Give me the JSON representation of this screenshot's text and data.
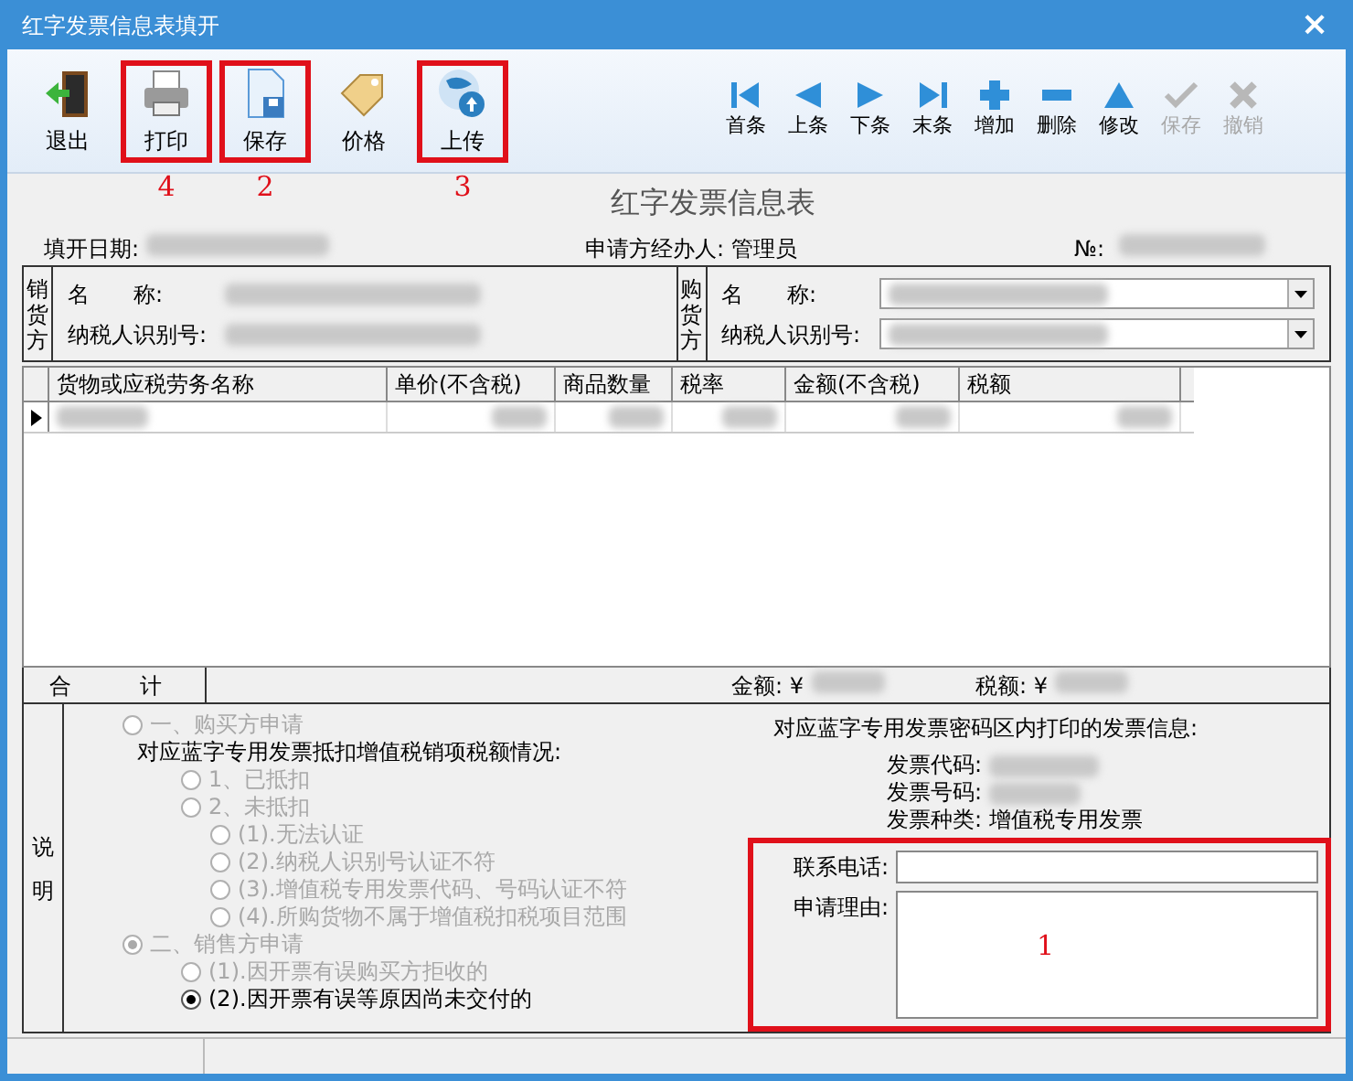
{
  "window": {
    "title": "红字发票信息表填开",
    "close": "×"
  },
  "toolbar": {
    "left": [
      {
        "label": "退出"
      },
      {
        "label": "打印",
        "annotation": "4"
      },
      {
        "label": "保存",
        "annotation": "2"
      },
      {
        "label": "价格"
      },
      {
        "label": "上传",
        "annotation": "3"
      }
    ],
    "right": [
      {
        "label": "首条",
        "disabled": false
      },
      {
        "label": "上条",
        "disabled": false
      },
      {
        "label": "下条",
        "disabled": false
      },
      {
        "label": "末条",
        "disabled": false
      },
      {
        "label": "增加",
        "disabled": false
      },
      {
        "label": "删除",
        "disabled": false
      },
      {
        "label": "修改",
        "disabled": false
      },
      {
        "label": "保存",
        "disabled": true
      },
      {
        "label": "撤销",
        "disabled": true
      }
    ]
  },
  "form": {
    "heading": "红字发票信息表",
    "date_label": "填开日期:",
    "handler": "申请方经办人: 管理员",
    "number_label": "№:"
  },
  "parties": [
    {
      "side": "销货方",
      "name_label": "名　　称:",
      "tax_label": "纳税人识别号:",
      "dropdown": false
    },
    {
      "side": "购货方",
      "name_label": "名　　称:",
      "tax_label": "纳税人识别号:",
      "dropdown": true
    }
  ],
  "table": {
    "columns": [
      "货物或应税劳务名称",
      "单价(不含税)",
      "商品数量",
      "税率",
      "金额(不含税)",
      "税额"
    ],
    "rows": [
      {
        "selected": true
      }
    ]
  },
  "totals": {
    "label_1": "合",
    "label_2": "计",
    "amount_label": "金额: ¥",
    "tax_label": "税额: ¥"
  },
  "notes": {
    "side": "说明",
    "options": [
      {
        "kind": "radio",
        "label": "一、购买方申请",
        "selected": false,
        "disabled": true,
        "children": [
          {
            "kind": "text",
            "label": "对应蓝字专用发票抵扣增值税销项税额情况:"
          },
          {
            "kind": "radio",
            "label": "1、已抵扣",
            "selected": false,
            "disabled": true
          },
          {
            "kind": "radio",
            "label": "2、未抵扣",
            "selected": false,
            "disabled": true,
            "children": [
              {
                "kind": "radio",
                "label": "(1).无法认证",
                "selected": false,
                "disabled": true
              },
              {
                "kind": "radio",
                "label": "(2).纳税人识别号认证不符",
                "selected": false,
                "disabled": true
              },
              {
                "kind": "radio",
                "label": "(3).增值税专用发票代码、号码认证不符",
                "selected": false,
                "disabled": true
              },
              {
                "kind": "radio",
                "label": "(4).所购货物不属于增值税扣税项目范围",
                "selected": false,
                "disabled": true
              }
            ]
          }
        ]
      },
      {
        "kind": "radio",
        "label": "二、销售方申请",
        "selected": true,
        "disabled": true,
        "children": [
          {
            "kind": "radio",
            "label": "(1).因开票有误购买方拒收的",
            "selected": false,
            "disabled": true
          },
          {
            "kind": "radio",
            "label": "(2).因开票有误等原因尚未交付的",
            "selected": true,
            "disabled": false
          }
        ]
      }
    ],
    "invoice_info_title": "对应蓝字专用发票密码区内打印的发票信息:",
    "invoice_code_label": "发票代码:",
    "invoice_number_label": "发票号码:",
    "invoice_type": "发票种类: 增值税专用发票",
    "phone_label": "联系电话:",
    "reason_label": "申请理由:",
    "annotation": "1"
  }
}
